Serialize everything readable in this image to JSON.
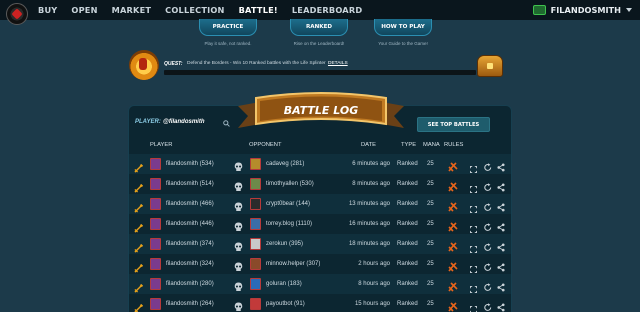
{
  "nav": {
    "items": [
      "BUY",
      "OPEN",
      "MARKET",
      "COLLECTION",
      "BATTLE!",
      "LEADERBOARD"
    ],
    "active": "BATTLE!",
    "username": "FILANDOSMITH"
  },
  "modes": [
    {
      "label": "PRACTICE",
      "desc": "Play it safe, not ranked."
    },
    {
      "label": "RANKED",
      "desc": "Rise on the Leaderboard!"
    },
    {
      "label": "HOW TO PLAY",
      "desc": "Your Guide to the Game!"
    }
  ],
  "quest": {
    "label": "QUEST:",
    "text": "Defend the Borders - Win 10 Ranked battles with the Life Splinter",
    "details": "DETAILS",
    "progress": 0
  },
  "battle_log": {
    "title": "BATTLE LOG",
    "player_label": "PLAYER:",
    "player_name": "@filandosmith",
    "top_battles": "SEE TOP BATTLES",
    "columns": {
      "player": "PLAYER",
      "opponent": "OPPONENT",
      "date": "DATE",
      "type": "TYPE",
      "mana": "MANA",
      "rules": "RULES"
    },
    "rows": [
      {
        "player": "filandosmith (534)",
        "opponent": "cadaveg (281)",
        "date": "6 minutes ago",
        "type": "Ranked",
        "mana": "25",
        "p_color": "#7a3b8e",
        "o_color": "#b58c2b"
      },
      {
        "player": "filandosmith (514)",
        "opponent": "timothyallen (530)",
        "date": "8 minutes ago",
        "type": "Ranked",
        "mana": "25",
        "p_color": "#7a3b8e",
        "o_color": "#6d8a4a"
      },
      {
        "player": "filandosmith (466)",
        "opponent": "crypt0bear (144)",
        "date": "13 minutes ago",
        "type": "Ranked",
        "mana": "25",
        "p_color": "#7a3b8e",
        "o_color": "#2b2b2b"
      },
      {
        "player": "filandosmith (446)",
        "opponent": "torrey.blog (1110)",
        "date": "16 minutes ago",
        "type": "Ranked",
        "mana": "25",
        "p_color": "#7a3b8e",
        "o_color": "#3a6ea8"
      },
      {
        "player": "filandosmith (374)",
        "opponent": "zerokun (395)",
        "date": "18 minutes ago",
        "type": "Ranked",
        "mana": "25",
        "p_color": "#7a3b8e",
        "o_color": "#c9c9c9"
      },
      {
        "player": "filandosmith (324)",
        "opponent": "minnow.helper (307)",
        "date": "2 hours ago",
        "type": "Ranked",
        "mana": "25",
        "p_color": "#7a3b8e",
        "o_color": "#8a4a2a"
      },
      {
        "player": "filandosmith (280)",
        "opponent": "goluran (183)",
        "date": "8 hours ago",
        "type": "Ranked",
        "mana": "25",
        "p_color": "#7a3b8e",
        "o_color": "#2a6bb8"
      },
      {
        "player": "filandosmith (264)",
        "opponent": "payoutbot (91)",
        "date": "15 hours ago",
        "type": "Ranked",
        "mana": "25",
        "p_color": "#7a3b8e",
        "o_color": "#c23a3a"
      }
    ]
  },
  "colors": {
    "background": "#1c3a4a",
    "nav": "#0a161d",
    "panel": "#0c2631",
    "accent": "#1e5c6c",
    "banner": "#6a4016"
  },
  "icons": [
    "logo-icon",
    "user-avatar-icon",
    "quest-icon",
    "chest-icon",
    "search-icon",
    "sword-icon",
    "skull-icon",
    "rule-icon",
    "fullscreen-icon",
    "replay-icon",
    "share-icon"
  ]
}
